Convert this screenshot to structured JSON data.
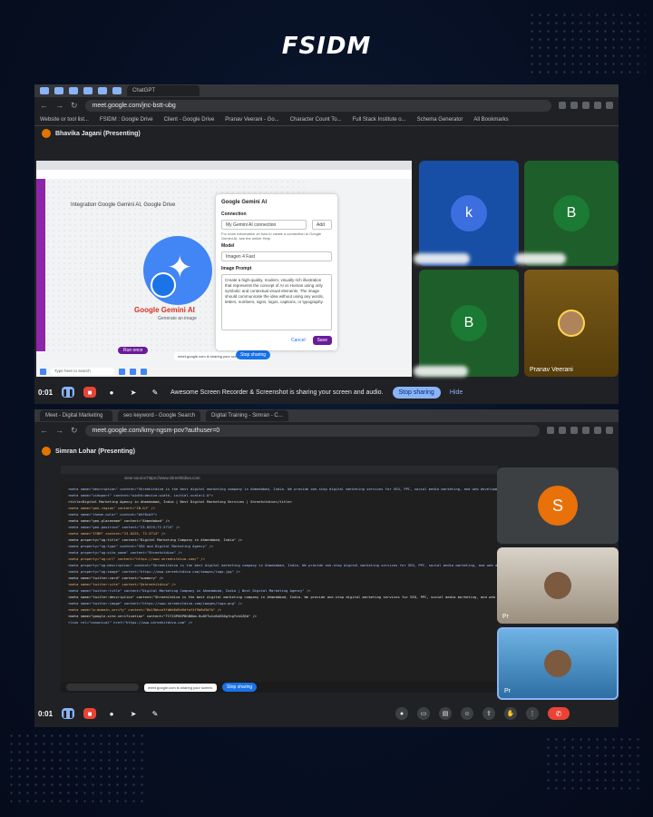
{
  "brand": {
    "logo": "FSIDM"
  },
  "top": {
    "chrome_tab_title": "ChatGPT",
    "url": "meet.google.com/jnc-bstt-ubg",
    "bookmarks": [
      "Website or tool list...",
      "FSIDM : Google Drive",
      "Client - Google Drive",
      "Pranav Veerani - Go...",
      "Character Count To...",
      "Full Stack Institute o...",
      "Schema Generator",
      "All Bookmarks"
    ],
    "presenter": "Bhavika Jagani (Presenting)",
    "shared_screen": {
      "page_heading": "Integration Google Gemini AI, Google Drive",
      "app_name": "Google Gemini AI",
      "app_subtitle": "Generate an image",
      "run_once": "Run once",
      "share_notice": "meet.google.com is sharing your screen.",
      "stop_sharing_mini": "Stop sharing",
      "panel": {
        "title": "Google Gemini AI",
        "connection_label": "Connection",
        "connection_value": "My Gemini AI connection",
        "add": "Add",
        "help": "For more information on how to create a connection to Google Gemini AI, see the online Help.",
        "model_label": "Model",
        "model_value": "Imagen 4 Fast",
        "prompt_label": "Image Prompt",
        "prompt_text": "Create a high-quality, modern, visually rich illustration that represents the concept of AI vs Human using only symbolic and contextual visual elements. The image should communicate the idea without using any words, letters, numbers, signs, logos, captions, or typography.",
        "cancel": "Cancel",
        "save": "Save"
      },
      "taskbar_search": "Type here to search"
    },
    "participants": [
      {
        "initial": "k",
        "name": ""
      },
      {
        "initial": "B",
        "name": ""
      },
      {
        "initial": "B",
        "name": ""
      },
      {
        "initial": "",
        "name": "Pranav Veerani"
      }
    ],
    "controls": {
      "timer": "0:01",
      "sharing_text": "Awesome Screen Recorder & Screenshot is sharing your screen and audio.",
      "stop_sharing": "Stop sharing",
      "hide": "Hide"
    }
  },
  "bottom": {
    "tab_1": "Meet - Digital Marketing",
    "tab_2": "seo keyword - Google Search",
    "tab_3": "Digital Training - Simran - C...",
    "url": "meet.google.com/kmy-ngsm-pov?authuser=0",
    "presenter": "Simran Lohar (Presenting)",
    "code_url": "view-source:https://www.shreehitdiva.com",
    "code_lines": [
      "<meta name=\"description\" content=\"Shreehitdiva is the best digital marketing company in Ahmedabad, India. We provide one-stop digital marketing services for SEO, PPC, social media marketing, and web development.\" />",
      "<meta name=\"viewport\" content=\"width=device-width, initial-scale=1.0\">",
      "<title>Digital Marketing Agency in Ahmedabad, India | Best Digital Marketing Services | Shreehitdiva</title>",
      "<meta name=\"geo.region\" content=\"IN-GJ\" />",
      "<meta name=\"theme-color\" content=\"#4f8cb3\">",
      "<meta name=\"geo.placename\" content=\"Ahmedabad\" />",
      "<meta name=\"geo.position\" content=\"23.0225;72.5714\" />",
      "<meta name=\"ICBM\" content=\"23.0225, 72.5714\" />",
      "<meta property=\"og:title\" content=\"Digital Marketing Company in Ahmedabad, India\" />",
      "<meta property=\"og:type\" content=\"SEO and Digital Marketing Agency\" />",
      "<meta property=\"og:site_name\" content=\"Shreehitdiva\" />",
      "<meta property=\"og:url\" content=\"https://www.shreehitdiva.com/\" />",
      "<meta property=\"og:description\" content=\"Shreehitdiva is the best digital marketing company in Ahmedabad, India. We provide one-stop digital marketing services for SEO, PPC, social media marketing, and web development.\" />",
      "<meta property=\"og:image\" content=\"https://www.shreehitdiva.com/images/logo.jpg\" />",
      "<meta name=\"twitter:card\" content=\"summary\" />",
      "<meta name=\"twitter:site\" content=\"@shreehitdiva\" />",
      "<meta name=\"twitter:title\" content=\"Digital Marketing Company in Ahmedabad, India | Best Digital Marketing Agency\" />",
      "<meta name=\"twitter:description\" content=\"Shreehitdiva is the best digital marketing company in Ahmedabad, India. We provide one-stop digital marketing services for SEO, PPC, social media marketing, and web development.\" />",
      "<meta name=\"twitter:image\" content=\"https://www.shreehitdiva.com/images/logo.png\" />",
      "<meta name=\"p:domain_verify\" content=\"8a19bbce3fd6d6d9a9dfaf4f5b8d3d7a\" />",
      "<meta name=\"google-site-verification\" content=\"TCfIXP6KP8hB6bm-Hu8VTw1z8dZG6g7ngTvkXZQb\" />",
      "<link rel=\"canonical\" href=\"https://www.shreehitdiva.com\" />"
    ],
    "share_notice": "meet.google.com is sharing your screen.",
    "stop_sharing_mini": "Stop sharing",
    "participants": [
      {
        "initial": "S",
        "name": ""
      },
      {
        "initial": "",
        "name": "Pr"
      },
      {
        "initial": "",
        "name": "Pr"
      }
    ],
    "controls": {
      "timer": "0:01"
    }
  }
}
